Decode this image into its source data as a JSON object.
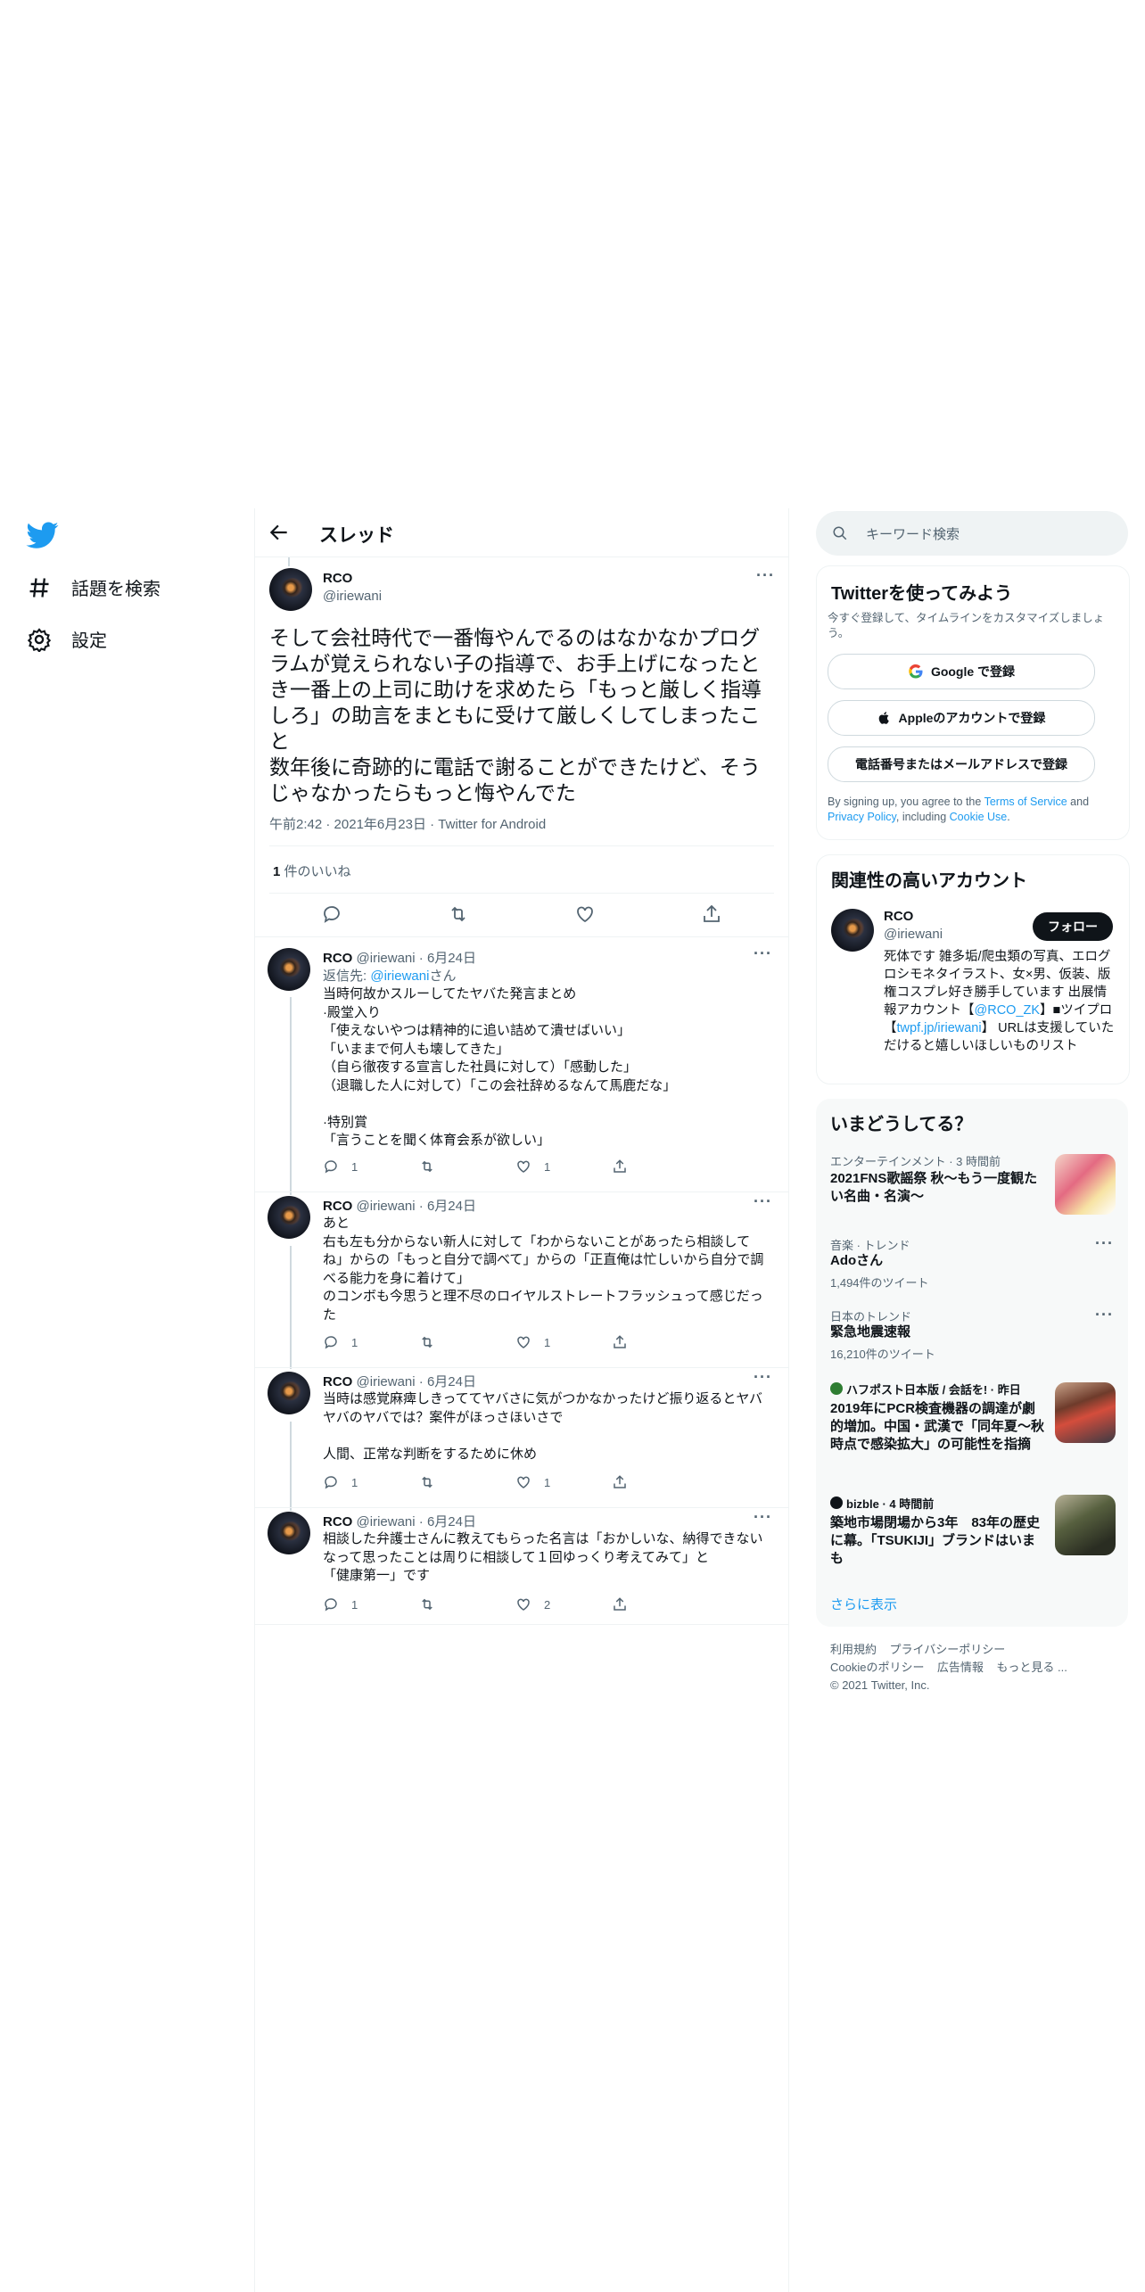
{
  "nav": {
    "explore_label": "話題を検索",
    "settings_label": "設定"
  },
  "header": {
    "title": "スレッド"
  },
  "main_tweet": {
    "name": "RCO",
    "handle": "@iriewani",
    "text": "そして会社時代で一番悔やんでるのはなかなかプログラムが覚えられない子の指導で、お手上げになったとき一番上の上司に助けを求めたら「もっと厳しく指導しろ」の助言をまともに受けて厳しくしてしまったこと\n数年後に奇跡的に電話で謝ることができたけど、そうじゃなかったらもっと悔やんでた",
    "time": "午前2:42",
    "date": "2021年6月23日",
    "source": "Twitter for Android",
    "likes_count": "1",
    "likes_label": " 件のいいね"
  },
  "replies": [
    {
      "name": "RCO",
      "handle": "@iriewani",
      "date": "· 6月24日",
      "reply_to_prefix": "返信先: ",
      "reply_to_handle": "@iriewani",
      "reply_to_suffix": "さん",
      "text": "当時何故かスルーしてたヤバた発言まとめ\n·殿堂入り\n「使えないやつは精神的に追い詰めて潰せばいい」\n「いままで何人も壊してきた」\n（自ら徹夜する宣言した社員に対して）「感動した」\n（退職した人に対して）「この会社辞めるなんて馬鹿だな」\n\n·特別賞\n「言うことを聞く体育会系が欲しい」",
      "reply_count": "1",
      "retweet_count": "",
      "like_count": "1"
    },
    {
      "name": "RCO",
      "handle": "@iriewani",
      "date": "· 6月24日",
      "text": "あと\n右も左も分からない新人に対して「わからないことがあったら相談してね」からの「もっと自分で調べて」からの「正直俺は忙しいから自分で調べる能力を身に着けて」\nのコンボも今思うと理不尽のロイヤルストレートフラッシュって感じだった",
      "reply_count": "1",
      "retweet_count": "",
      "like_count": "1"
    },
    {
      "name": "RCO",
      "handle": "@iriewani",
      "date": "· 6月24日",
      "text": "当時は感覚麻痺しきっててヤバさに気がつかなかったけど振り返るとヤバヤバのヤバでは？案件がほっさほいさで\n\n人間、正常な判断をするために休め",
      "reply_count": "1",
      "retweet_count": "",
      "like_count": "1"
    },
    {
      "name": "RCO",
      "handle": "@iriewani",
      "date": "· 6月24日",
      "text": "相談した弁護士さんに教えてもらった名言は「おかしいな、納得できないなって思ったことは周りに相談して１回ゆっくり考えてみて」と\n「健康第一」です",
      "reply_count": "1",
      "retweet_count": "",
      "like_count": "2"
    }
  ],
  "search": {
    "placeholder": "キーワード検索"
  },
  "signup": {
    "title": "Twitterを使ってみよう",
    "subtitle": "今すぐ登録して、タイムラインをカスタマイズしましょう。",
    "google_label": "Google で登録",
    "apple_label": "Appleのアカウントで登録",
    "phone_label": "電話番号またはメールアドレスで登録",
    "terms_prefix": "By signing up, you agree to the ",
    "terms_link": "Terms of Service",
    "terms_mid": " and ",
    "privacy_link": "Privacy Policy",
    "terms_mid2": ", including ",
    "cookie_link": "Cookie Use",
    "terms_end": "."
  },
  "related": {
    "title": "関連性の高いアカウント",
    "name": "RCO",
    "handle": "@iriewani",
    "follow_label": "フォロー",
    "bio_1": "死体です 雑多垢/爬虫類の写真、エログロシモネタイラスト、女×男、仮装、版権コスプレ好き勝手しています 出展情報アカウント【",
    "bio_link_1": "@RCO_ZK",
    "bio_2": "】■ツイプロ【",
    "bio_link_2": "twpf.jp/iriewani",
    "bio_3": "】 URLは支援していただけると嬉しいほしいものリスト"
  },
  "trends": {
    "title": "いまどうしてる？",
    "items": [
      {
        "category": "エンターテインメント · 3 時間前",
        "title": "2021FNS歌謡祭 秋～もう一度観たい名曲・名演～",
        "count": ""
      },
      {
        "category": "音楽 · トレンド",
        "title": "Adoさん",
        "count": "1,494件のツイート"
      },
      {
        "category": "日本のトレンド",
        "title": "緊急地震速報",
        "count": "16,210件のツイート"
      },
      {
        "category": "ハフポスト日本版 / 会話を! · 昨日",
        "title": "2019年にPCR検査機器の調達が劇的増加。中国・武漢で「同年夏〜秋時点で感染拡大」の可能性を指摘",
        "count": ""
      },
      {
        "category": "bizble · 4 時間前",
        "title": "築地市場閉場から3年　83年の歴史に幕。「TSUKIJI」ブランドはいまも",
        "count": ""
      }
    ],
    "show_more": "さらに表示"
  },
  "footer": {
    "terms": "利用規約",
    "privacy": "プライバシーポリシー",
    "cookie": "Cookieのポリシー",
    "ads": "広告情報",
    "more": "もっと見る ...",
    "copyright": "© 2021 Twitter, Inc."
  },
  "colors": {
    "accent": "#1d9bf0",
    "text": "#0f1419",
    "muted": "#536471",
    "panel": "#f7f9f9"
  }
}
